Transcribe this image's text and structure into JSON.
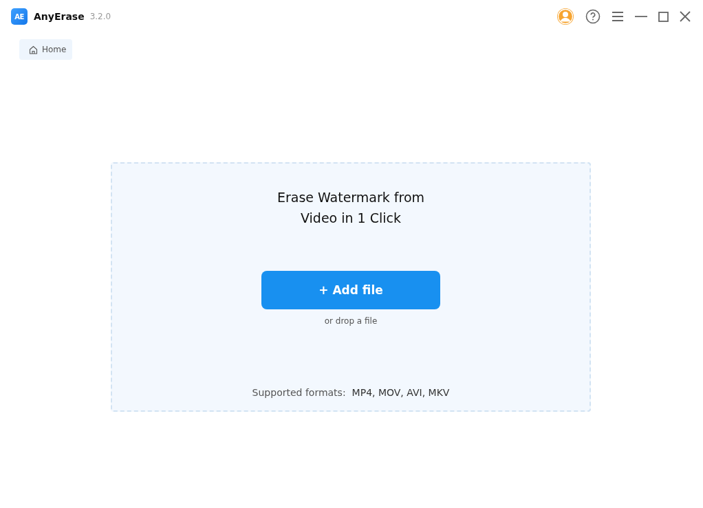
{
  "app": {
    "logo_text": "AE",
    "name": "AnyErase",
    "version": "3.2.0"
  },
  "breadcrumb": {
    "label": "Home"
  },
  "dropzone": {
    "title": "Erase Watermark from Video in 1 Click",
    "button": "+ Add file",
    "hint": "or drop a file",
    "formats_label": "Supported formats:",
    "formats": "MP4, MOV, AVI, MKV"
  }
}
